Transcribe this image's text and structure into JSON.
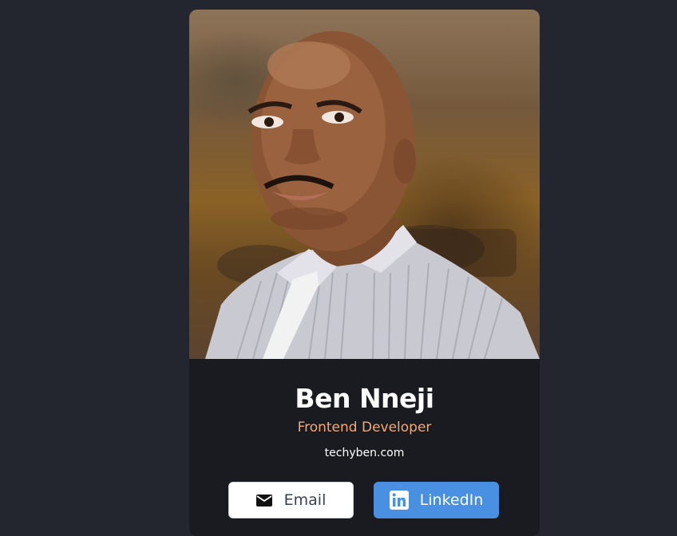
{
  "profile": {
    "name": "Ben Nneji",
    "role": "Frontend Developer",
    "website": "techyben.com",
    "photo_alt": "Ben Nneji",
    "photo_icon": "profile-photo"
  },
  "buttons": {
    "email_label": "Email",
    "email_icon": "envelope-icon",
    "linkedin_label": "LinkedIn",
    "linkedin_icon": "linkedin-icon"
  },
  "colors": {
    "page_background": "#23252f",
    "card_background": "#1a1b21",
    "name_color": "#ffffff",
    "role_color": "#f0a978",
    "email_button_bg": "#ffffff",
    "linkedin_button_bg": "#4a90e2"
  }
}
